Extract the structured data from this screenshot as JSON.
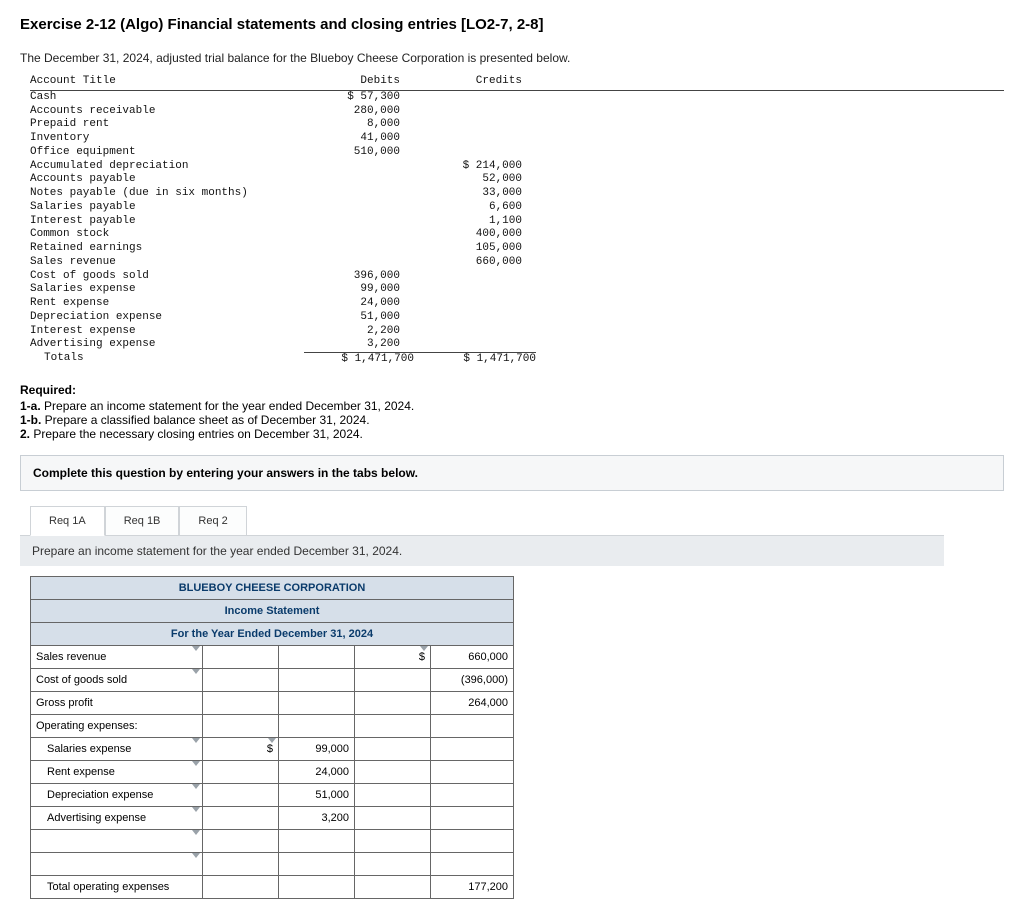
{
  "title": "Exercise 2-12 (Algo) Financial statements and closing entries [LO2-7, 2-8]",
  "intro": "The December 31, 2024, adjusted trial balance for the Blueboy Cheese Corporation is presented below.",
  "tb": {
    "headers": {
      "a": "Account Title",
      "d": "Debits",
      "c": "Credits"
    },
    "rows": [
      {
        "a": "Cash",
        "d": "$ 57,300",
        "c": ""
      },
      {
        "a": "Accounts receivable",
        "d": "280,000",
        "c": ""
      },
      {
        "a": "Prepaid rent",
        "d": "8,000",
        "c": ""
      },
      {
        "a": "Inventory",
        "d": "41,000",
        "c": ""
      },
      {
        "a": "Office equipment",
        "d": "510,000",
        "c": ""
      },
      {
        "a": "Accumulated depreciation",
        "d": "",
        "c": "$  214,000"
      },
      {
        "a": "Accounts payable",
        "d": "",
        "c": "52,000"
      },
      {
        "a": "Notes payable (due in six months)",
        "d": "",
        "c": "33,000"
      },
      {
        "a": "Salaries payable",
        "d": "",
        "c": "6,600"
      },
      {
        "a": "Interest payable",
        "d": "",
        "c": "1,100"
      },
      {
        "a": "Common stock",
        "d": "",
        "c": "400,000"
      },
      {
        "a": "Retained earnings",
        "d": "",
        "c": "105,000"
      },
      {
        "a": "Sales revenue",
        "d": "",
        "c": "660,000"
      },
      {
        "a": "Cost of goods sold",
        "d": "396,000",
        "c": ""
      },
      {
        "a": "Salaries expense",
        "d": "99,000",
        "c": ""
      },
      {
        "a": "Rent expense",
        "d": "24,000",
        "c": ""
      },
      {
        "a": "Depreciation expense",
        "d": "51,000",
        "c": ""
      },
      {
        "a": "Interest expense",
        "d": "2,200",
        "c": ""
      },
      {
        "a": "Advertising expense",
        "d": "3,200",
        "c": ""
      }
    ],
    "totals": {
      "a": "Totals",
      "d": "$ 1,471,700",
      "c": "$ 1,471,700"
    }
  },
  "required": {
    "head": "Required:",
    "items": [
      {
        "b": "1-a.",
        "t": " Prepare an income statement for the year ended December 31, 2024."
      },
      {
        "b": "1-b.",
        "t": " Prepare a classified balance sheet as of December 31, 2024."
      },
      {
        "b": "2.",
        "t": " Prepare the necessary closing entries on December 31, 2024."
      }
    ]
  },
  "panel": "Complete this question by entering your answers in the tabs below.",
  "tabs": {
    "a": "Req 1A",
    "b": "Req 1B",
    "c": "Req 2"
  },
  "tabbar": "Prepare an income statement for the year ended December 31, 2024.",
  "is": {
    "h1": "BLUEBOY CHEESE CORPORATION",
    "h2": "Income Statement",
    "h3": "For the Year Ended December 31, 2024",
    "rows": {
      "sales": {
        "label": "Sales revenue",
        "sym": "$",
        "big": "660,000"
      },
      "cogs": {
        "label": "Cost of goods sold",
        "big": "(396,000)"
      },
      "gp": {
        "label": "Gross profit",
        "big": "264,000"
      },
      "opx": {
        "label": "Operating expenses:"
      },
      "sal": {
        "label": "Salaries expense",
        "ssym": "$",
        "small": "99,000"
      },
      "rent": {
        "label": "Rent expense",
        "small": "24,000"
      },
      "dep": {
        "label": "Depreciation expense",
        "small": "51,000"
      },
      "adv": {
        "label": "Advertising expense",
        "small": "3,200"
      },
      "blank1": {
        "label": ""
      },
      "blank2": {
        "label": ""
      },
      "totopx": {
        "label": "Total operating expenses",
        "big": "177,200"
      }
    }
  }
}
